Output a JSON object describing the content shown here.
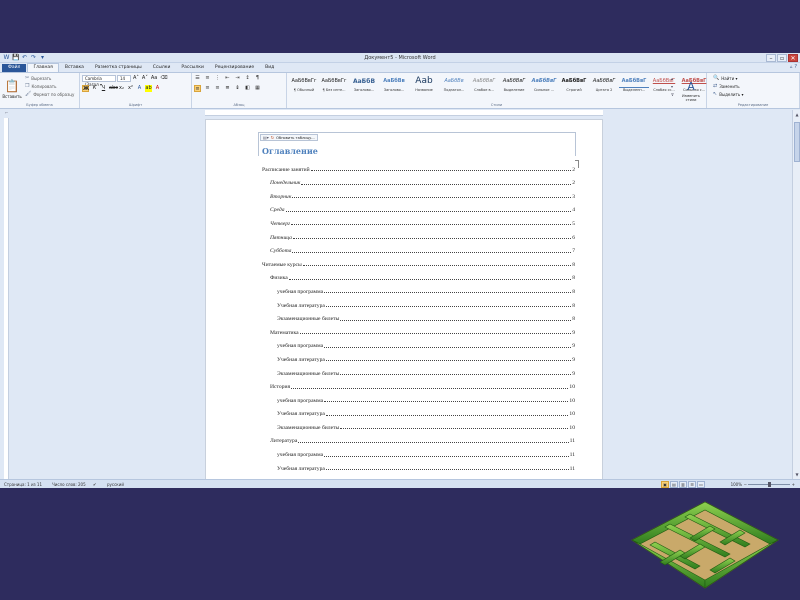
{
  "window": {
    "title": "Документ5 - Microsoft Word",
    "qat": [
      "W",
      "💾",
      "↶",
      "↷",
      "▾"
    ],
    "controls": [
      "–",
      "▫",
      "✕"
    ]
  },
  "tabs": [
    {
      "label": "Файл"
    },
    {
      "label": "Главная"
    },
    {
      "label": "Вставка"
    },
    {
      "label": "Разметка страницы"
    },
    {
      "label": "Ссылки"
    },
    {
      "label": "Рассылки"
    },
    {
      "label": "Рецензирование"
    },
    {
      "label": "Вид"
    }
  ],
  "ribbon": {
    "clipboard": {
      "paste": "Вставить",
      "cut": "Вырезать",
      "copy": "Копировать",
      "format_painter": "Формат по образцу",
      "group": "Буфер обмена"
    },
    "font": {
      "name": "Cambria (Загол ▾",
      "size": "14",
      "group": "Шрифт"
    },
    "paragraph": {
      "group": "Абзац"
    },
    "styles": {
      "items": [
        {
          "sample": "АаБбВвГг",
          "name": "¶ Обычный"
        },
        {
          "sample": "АаБбВвГг",
          "name": "¶ Без инте..."
        },
        {
          "sample": "АаБбВ",
          "name": "Заголово..."
        },
        {
          "sample": "АаБбВв",
          "name": "Заголово..."
        },
        {
          "sample": "Aab",
          "name": "Название"
        },
        {
          "sample": "АаБбВв",
          "name": "Подзагол..."
        },
        {
          "sample": "АаБбВвГ",
          "name": "Слабое в..."
        },
        {
          "sample": "АаБбВвГ",
          "name": "Выделение"
        },
        {
          "sample": "АаБбВвГ",
          "name": "Сильное ..."
        },
        {
          "sample": "АаБбВвГ",
          "name": "Строгий"
        },
        {
          "sample": "АаБбВвГ",
          "name": "Цитата 2"
        },
        {
          "sample": "АаБбВвГ",
          "name": "Выделенн..."
        },
        {
          "sample": "АаБбВвГ",
          "name": "Слабая сс..."
        },
        {
          "sample": "АаБбВвГ",
          "name": "Сильная с..."
        }
      ],
      "change": "Изменить стили",
      "group": "Стили"
    },
    "editing": {
      "find": "Найти ▾",
      "replace": "Заменить",
      "select": "Выделить ▾",
      "group": "Редактирование"
    }
  },
  "toc": {
    "update_label": "Обновить таблицу...",
    "heading": "Оглавление",
    "entries": [
      {
        "text": "Расписание занятий",
        "page": "2"
      },
      {
        "text": "Понедельник",
        "page": "2"
      },
      {
        "text": "Вторник",
        "page": "3"
      },
      {
        "text": "Среда",
        "page": "4"
      },
      {
        "text": "Четверг",
        "page": "5"
      },
      {
        "text": "Пятница",
        "page": "6"
      },
      {
        "text": "Суббота",
        "page": "7"
      },
      {
        "text": "Читаемые курсы",
        "page": "8"
      },
      {
        "text": "Физика",
        "page": "8"
      },
      {
        "text": "учебная программа",
        "page": "8"
      },
      {
        "text": "Учебная литература",
        "page": "8"
      },
      {
        "text": "Экзаменационные билеты",
        "page": "8"
      },
      {
        "text": "Математика",
        "page": "9"
      },
      {
        "text": "учебная программа",
        "page": "9"
      },
      {
        "text": "Учебная литература",
        "page": "9"
      },
      {
        "text": "Экзаменационные билеты",
        "page": "9"
      },
      {
        "text": "История",
        "page": "10"
      },
      {
        "text": "учебная программа",
        "page": "10"
      },
      {
        "text": "Учебная литература",
        "page": "10"
      },
      {
        "text": "Экзаменационные билеты",
        "page": "10"
      },
      {
        "text": "Литература",
        "page": "11"
      },
      {
        "text": "учебная программа",
        "page": "11"
      },
      {
        "text": "Учебная литература",
        "page": "11"
      }
    ]
  },
  "status": {
    "page": "Страница: 1 из 11",
    "words": "Число слов: 205",
    "language": "русский",
    "zoom": "100%"
  }
}
